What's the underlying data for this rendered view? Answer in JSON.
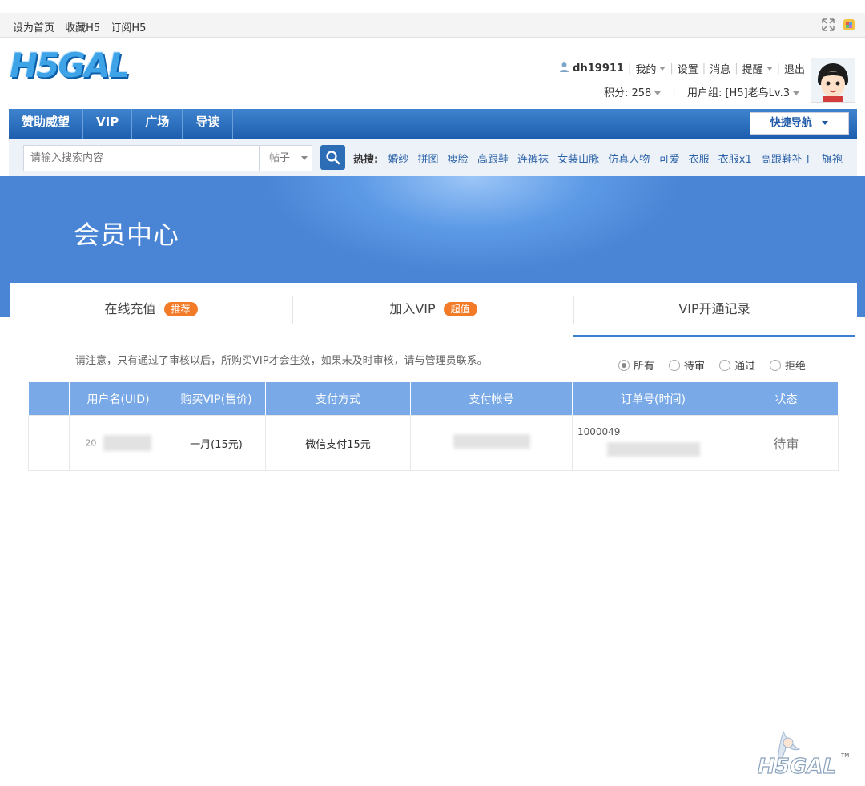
{
  "topbar": {
    "set_home": "设为首页",
    "favorite": "收藏H5",
    "subscribe": "订阅H5"
  },
  "header": {
    "logo": "H5GAL",
    "username": "dh19911",
    "menu": [
      "我的",
      "设置",
      "消息",
      "提醒",
      "退出"
    ],
    "score": "积分: 258",
    "usergroup": "用户组: [H5]老鸟Lv.3"
  },
  "nav": {
    "items": [
      "赞助威望",
      "VIP",
      "广场",
      "导读"
    ],
    "quick": "快捷导航"
  },
  "search": {
    "placeholder": "请输入搜索内容",
    "type": "帖子",
    "hot_label": "热搜:",
    "hot": [
      "婚纱",
      "拼图",
      "瘦脸",
      "高跟鞋",
      "连裤袜",
      "女装山脉",
      "仿真人物",
      "可爱",
      "衣服",
      "衣服x1",
      "高跟鞋补丁",
      "旗袍"
    ]
  },
  "banner": {
    "title": "会员中心"
  },
  "tabs": [
    {
      "label": "在线充值",
      "badge": "推荐"
    },
    {
      "label": "加入VIP",
      "badge": "超值"
    },
    {
      "label": "VIP开通记录",
      "badge": ""
    }
  ],
  "notice": "请注意，只有通过了审核以后，所购买VIP才会生效，如果未及时审核，请与管理员联系。",
  "filters": [
    "所有",
    "待审",
    "通过",
    "拒绝"
  ],
  "table": {
    "headers": [
      "",
      "用户名(UID)",
      "购买VIP(售价)",
      "支付方式",
      "支付帐号",
      "订单号(时间)",
      "状态"
    ],
    "rows": [
      {
        "uid": "20",
        "vip": "一月(15元)",
        "pay": "微信支付15元",
        "account": "",
        "order": "1000049",
        "status": "待审"
      }
    ]
  },
  "watermark": "H5GAL"
}
